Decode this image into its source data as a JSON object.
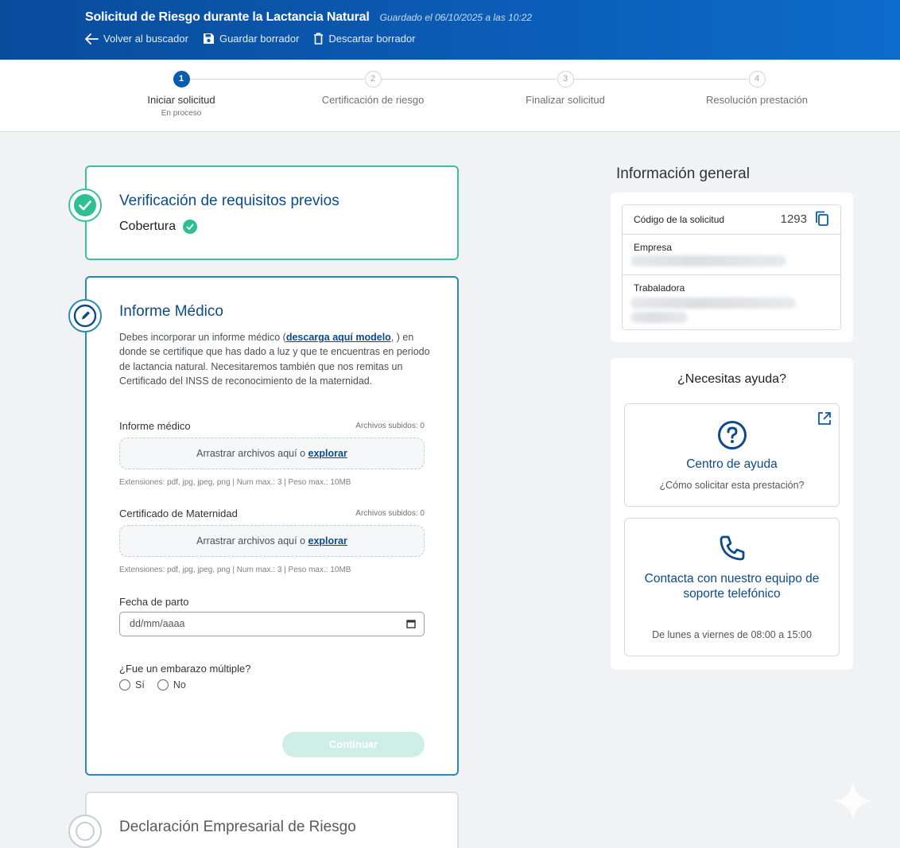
{
  "header": {
    "title": "Solicitud de Riesgo durante la Lactancia Natural",
    "saved": "Guardado el 06/10/2025 a las 10:22",
    "actions": [
      {
        "label": "Volver al buscador",
        "icon": "arrow-left-icon"
      },
      {
        "label": "Guardar borrador",
        "icon": "save-icon"
      },
      {
        "label": "Descartar borrador",
        "icon": "trash-icon"
      }
    ]
  },
  "stepper": {
    "steps": [
      {
        "number": "1",
        "label": "Iniciar solicitud",
        "status": "En proceso"
      },
      {
        "number": "2",
        "label": "Certificación de riesgo"
      },
      {
        "number": "3",
        "label": "Finalizar solicitud"
      },
      {
        "number": "4",
        "label": "Resolución prestación"
      }
    ]
  },
  "verificacion": {
    "title": "Verificación de requisitos previos",
    "item": "Cobertura"
  },
  "informe": {
    "title": "Informe Médico",
    "text_before": "Debes incorporar un informe médico (",
    "link": "descarga aquí modelo",
    "text_after": ", ) en donde se certifique que has dado a luz y que te encuentras en periodo de lactancia natural. Necesitaremos también que nos remitas un Certificado del INSS de reconocimiento de la maternidad.",
    "upload1": {
      "label": "Informe médico",
      "count": "Archivos subidos: 0",
      "drop_text": "Arrastrar archivos aquí o ",
      "explore": "explorar",
      "hint": "Extensiones: pdf, jpg, jpeg, png | Num max.: 3 | Peso max.: 10MB"
    },
    "upload2": {
      "label": "Certificado de Maternidad",
      "count": "Archivos subidos: 0",
      "drop_text": "Arrastrar archivos aquí o ",
      "explore": "explorar",
      "hint": "Extensiones: pdf, jpg, jpeg, png | Num max.: 3 | Peso max.: 10MB"
    },
    "date_label": "Fecha de parto",
    "date_placeholder": "dd/mm/aaaa",
    "multiple_question": "¿Fue un embarazo múltiple?",
    "options": [
      "Sí",
      "No"
    ],
    "continue": "Continuar"
  },
  "declaracion": {
    "title": "Declaración Empresarial de Riesgo"
  },
  "info_general": {
    "title": "Información general",
    "code_label": "Código de la solicitud",
    "code_value": "1293",
    "empresa_label": "Empresa",
    "trabajadora_label": "Trabaladora"
  },
  "help": {
    "title": "¿Necesitas ayuda?",
    "center_title": "Centro de ayuda",
    "center_sub": "¿Cómo solicitar esta prestación?",
    "phone_title": "Contacta con nuestro equipo de soporte telefónico",
    "phone_hours": "De lunes a viernes de 08:00 a 15:00"
  },
  "colors": {
    "header_blue": "#0b5cb5",
    "accent_teal": "#3dc0a0",
    "primary_text": "#0c4a8c"
  }
}
